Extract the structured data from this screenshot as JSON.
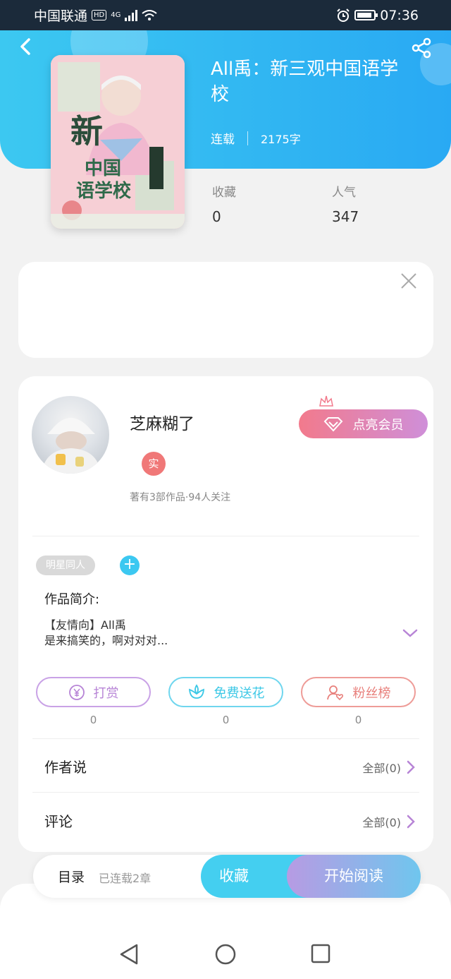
{
  "status_bar": {
    "carrier": "中国联通",
    "hd": "HD",
    "network": "4G",
    "time": "07:36"
  },
  "book": {
    "title": "All禹：新三观中国语学校",
    "status": "连载",
    "word_count": "2175字",
    "stats": [
      {
        "label": "收藏",
        "value": "0"
      },
      {
        "label": "人气",
        "value": "347"
      }
    ]
  },
  "cover": {
    "text_main": "新",
    "text_sub1": "中国",
    "text_sub2": "语学校"
  },
  "author": {
    "name": "芝麻糊了",
    "badge": "实",
    "stats": "著有3部作品·94人关注",
    "vip_button": "点亮会员"
  },
  "tags": {
    "items": [
      "明星同人"
    ],
    "add": "+"
  },
  "intro": {
    "label": "作品简介:",
    "line1": "【友情向】All禹",
    "line2": "是来搞笑的，啊对对对..."
  },
  "actions": [
    {
      "label": "打赏",
      "count": "0",
      "color": "#b784d6"
    },
    {
      "label": "免费送花",
      "count": "0",
      "color": "#3cc8e6"
    },
    {
      "label": "粉丝榜",
      "count": "0",
      "color": "#e8807c"
    }
  ],
  "rows": {
    "author_says": {
      "label": "作者说",
      "more": "全部(0)"
    },
    "comments": {
      "label": "评论",
      "more": "全部(0)"
    }
  },
  "bottom_bar": {
    "toc": "目录",
    "progress": "已连载2章",
    "collect": "收藏",
    "read": "开始阅读"
  }
}
